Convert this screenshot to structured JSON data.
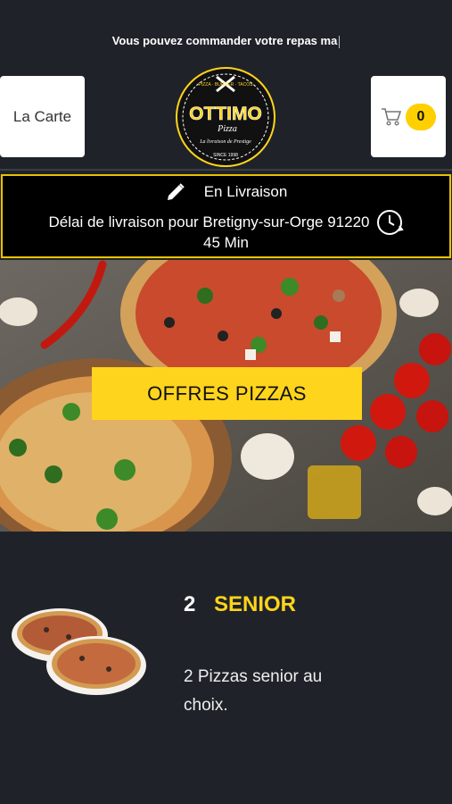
{
  "banner": {
    "text": "Vous pouvez commander votre repas ma"
  },
  "header": {
    "menu_label": "La Carte",
    "cart_count": "0",
    "logo": {
      "top_text": "PIZZA · BURGER · TACOS",
      "name": "OTTIMO",
      "sub": "Pizza",
      "tagline": "La livraison de Prestige",
      "since": "SINCE 1998"
    }
  },
  "delivery": {
    "mode": "En Livraison",
    "info": "Délai de livraison pour Bretigny-sur-Orge 91220",
    "time": "45 Min"
  },
  "hero": {
    "offer_label": "OFFRES PIZZAS"
  },
  "product": {
    "qty": "2",
    "name": "SENIOR",
    "description": "2 Pizzas senior au choix."
  },
  "colors": {
    "accent": "#ffd41c",
    "background": "#1f2329",
    "panel": "#000000"
  }
}
